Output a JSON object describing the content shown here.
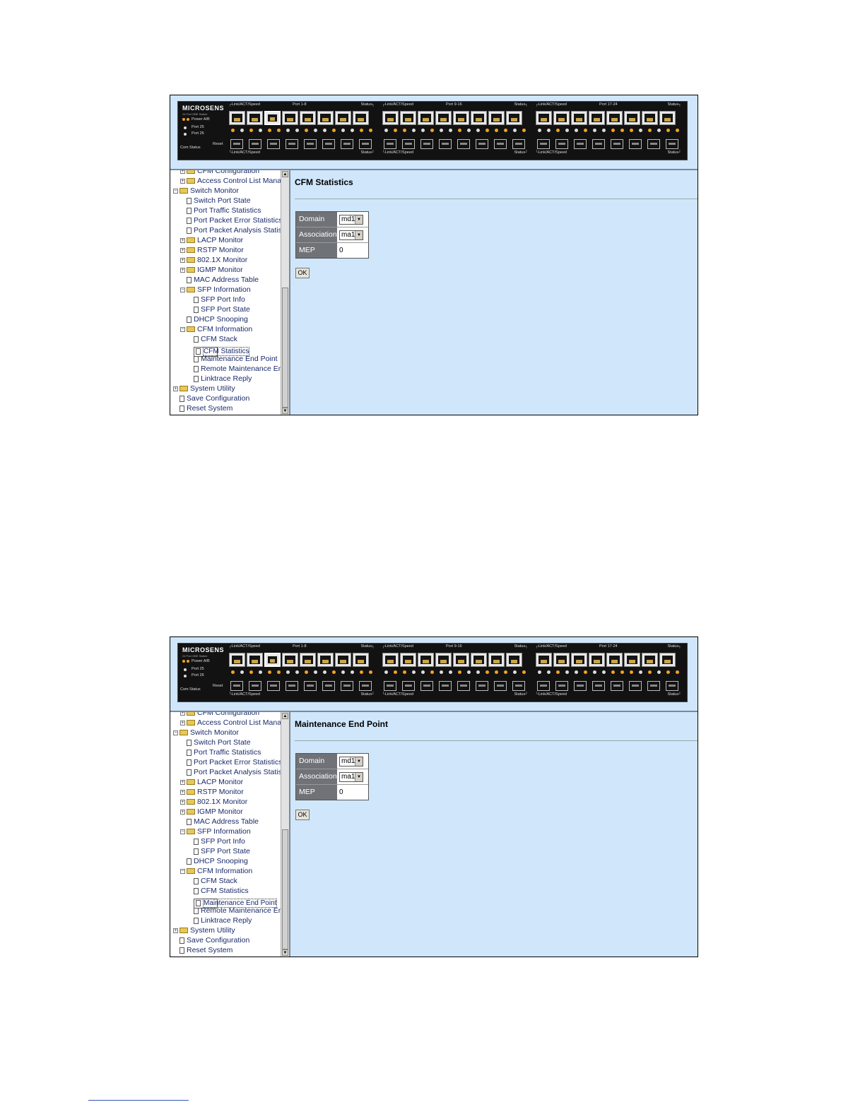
{
  "device": {
    "brand": "MICROSENS",
    "subtitle": "24 Port GBE Switch",
    "power_label": "Power A/B",
    "port25_label": "Port 25",
    "port26_label": "Port 26",
    "com_label": "Com",
    "status_label": "Status",
    "reset_label": "Reset",
    "groups": [
      {
        "top_left": "Link/ACT/Speed",
        "center": "Port 1-8",
        "top_right": "Status",
        "bottom_left": "Link/ACT/Speed",
        "bottom_right": "Status"
      },
      {
        "top_left": "Link/ACT/Speed",
        "center": "Port 9-16",
        "top_right": "Status",
        "bottom_left": "Link/ACT/Speed",
        "bottom_right": "Status"
      },
      {
        "top_left": "Link/ACT/Speed",
        "center": "Port 17-24",
        "top_right": "Status",
        "bottom_left": "Link/ACT/Speed",
        "bottom_right": "Status"
      }
    ]
  },
  "nav": {
    "items": [
      {
        "label": "CFM Configuration"
      },
      {
        "label": "Access Control List Manage"
      },
      {
        "label": "Switch Monitor"
      },
      {
        "label": "Switch Port State"
      },
      {
        "label": "Port Traffic Statistics"
      },
      {
        "label": "Port Packet Error Statistics"
      },
      {
        "label": "Port Packet Analysis Statist"
      },
      {
        "label": "LACP Monitor"
      },
      {
        "label": "RSTP Monitor"
      },
      {
        "label": "802.1X Monitor"
      },
      {
        "label": "IGMP Monitor"
      },
      {
        "label": "MAC Address Table"
      },
      {
        "label": "SFP Information"
      },
      {
        "label": "SFP Port Info"
      },
      {
        "label": "SFP Port State"
      },
      {
        "label": "DHCP Snooping"
      },
      {
        "label": "CFM Information"
      },
      {
        "label": "CFM Stack"
      },
      {
        "label": "CFM Statistics"
      },
      {
        "label": "Maintenance End Point"
      },
      {
        "label": "Remote Maintenance En"
      },
      {
        "label": "Linktrace Reply"
      },
      {
        "label": "System Utility"
      },
      {
        "label": "Save Configuration"
      },
      {
        "label": "Reset System"
      }
    ]
  },
  "screens": [
    {
      "title": "CFM Statistics",
      "selected_nav": "CFM Statistics",
      "form": {
        "domain_label": "Domain",
        "domain_value": "md1",
        "association_label": "Association",
        "association_value": "ma1",
        "mep_label": "MEP",
        "mep_value": "0"
      },
      "ok_label": "OK"
    },
    {
      "title": "Maintenance End Point",
      "selected_nav": "Maintenance End Point",
      "form": {
        "domain_label": "Domain",
        "domain_value": "md1",
        "association_label": "Association",
        "association_value": "ma1",
        "mep_label": "MEP",
        "mep_value": "0"
      },
      "ok_label": "OK"
    }
  ],
  "colors": {
    "panel_bg": "#cfe6fb",
    "label_bg": "#6f7277",
    "nav_text": "#1a2a6a",
    "led_orange": "#f4a21c",
    "device_bg": "#121212"
  }
}
